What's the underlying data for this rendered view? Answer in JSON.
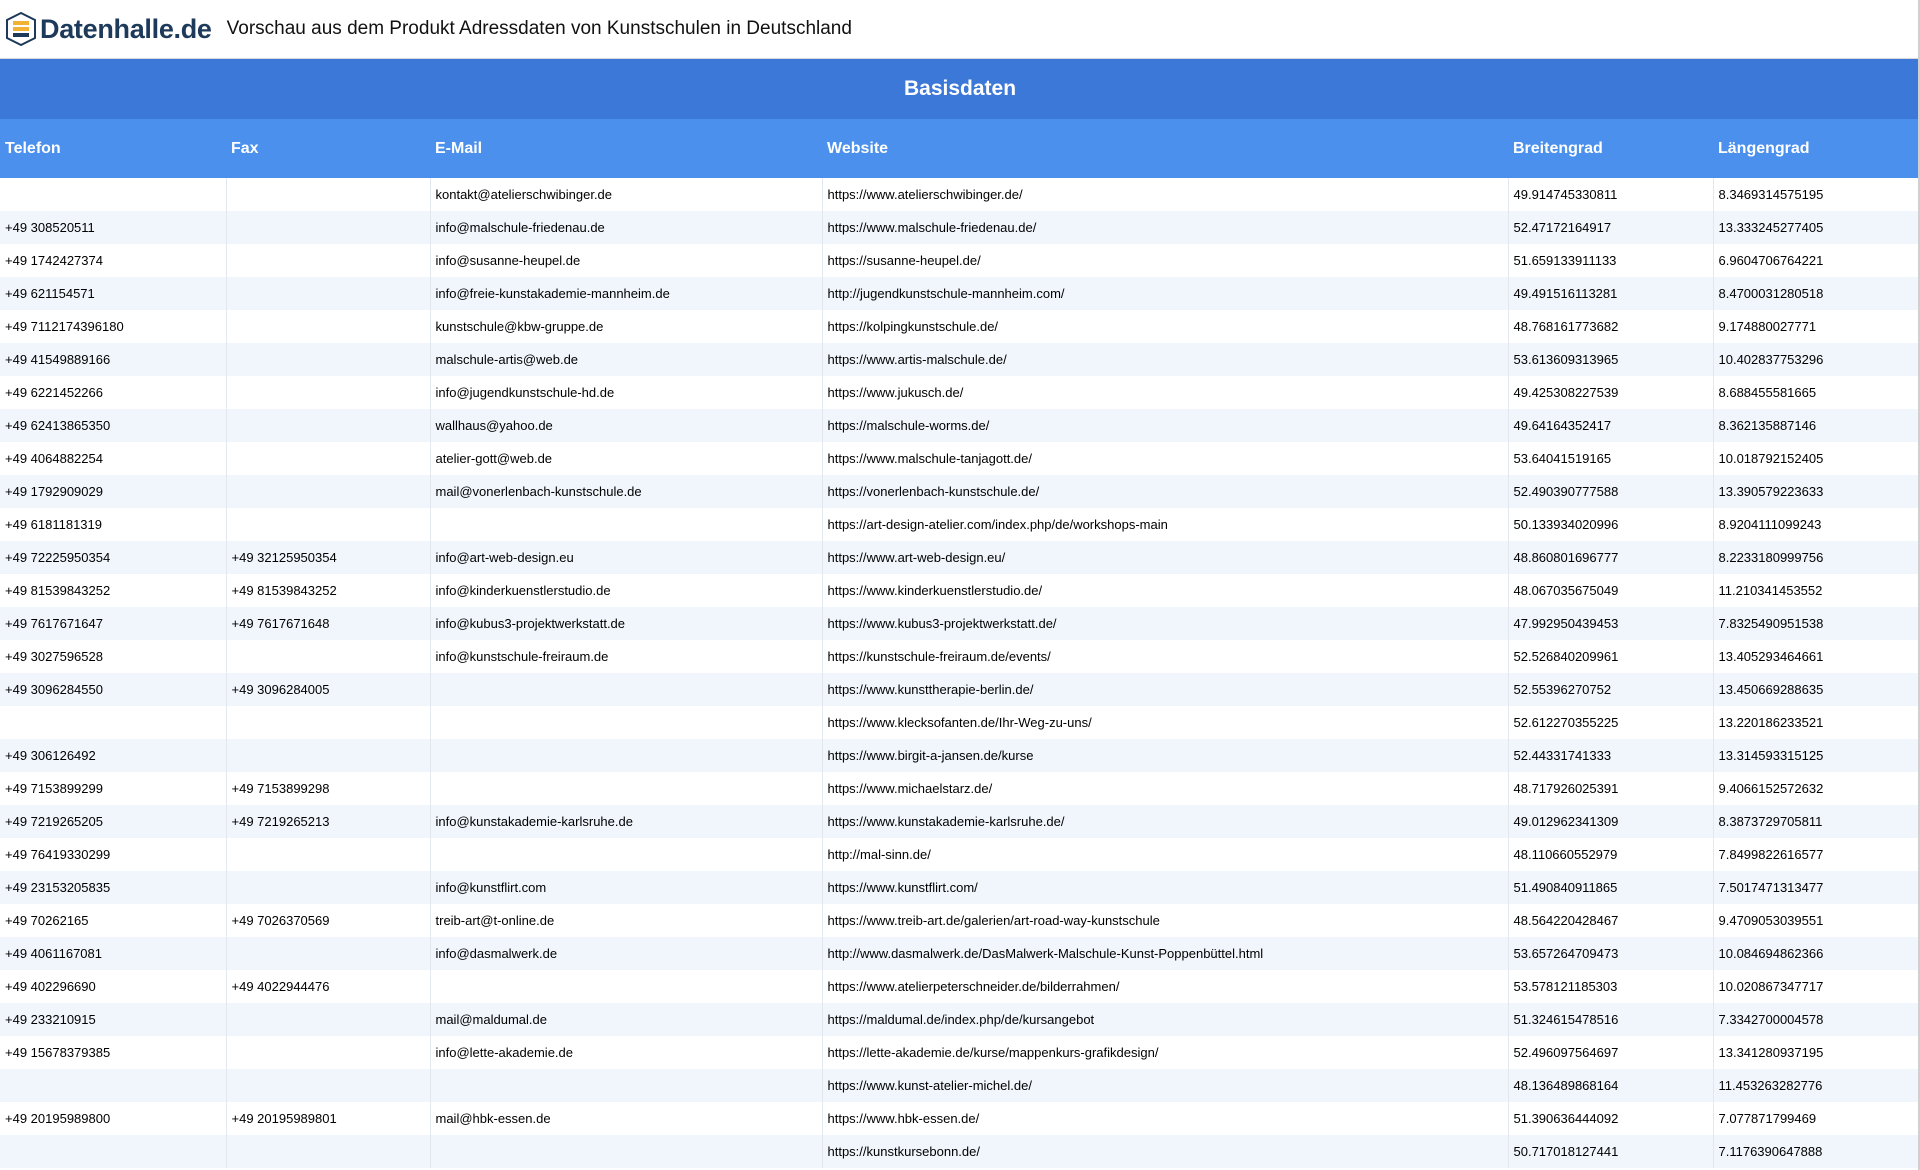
{
  "header": {
    "logo_text": "Datenhalle.de",
    "title": "Vorschau aus dem Produkt Adressdaten von Kunstschulen in Deutschland"
  },
  "table": {
    "group_label": "Basisdaten",
    "columns": [
      "Telefon",
      "Fax",
      "E-Mail",
      "Website",
      "Breitengrad",
      "Längengrad"
    ],
    "rows": [
      [
        "",
        "",
        "kontakt@atelierschwibinger.de",
        "https://www.atelierschwibinger.de/",
        "49.914745330811",
        "8.3469314575195"
      ],
      [
        "+49 308520511",
        "",
        "info@malschule-friedenau.de",
        "https://www.malschule-friedenau.de/",
        "52.47172164917",
        "13.333245277405"
      ],
      [
        "+49 1742427374",
        "",
        "info@susanne-heupel.de",
        "https://susanne-heupel.de/",
        "51.659133911133",
        "6.9604706764221"
      ],
      [
        "+49 621154571",
        "",
        "info@freie-kunstakademie-mannheim.de",
        "http://jugendkunstschule-mannheim.com/",
        "49.491516113281",
        "8.4700031280518"
      ],
      [
        "+49 7112174396180",
        "",
        "kunstschule@kbw-gruppe.de",
        "https://kolpingkunstschule.de/",
        "48.768161773682",
        "9.174880027771"
      ],
      [
        "+49 41549889166",
        "",
        "malschule-artis@web.de",
        "https://www.artis-malschule.de/",
        "53.613609313965",
        "10.402837753296"
      ],
      [
        "+49 6221452266",
        "",
        "info@jugendkunstschule-hd.de",
        "https://www.jukusch.de/",
        "49.425308227539",
        "8.688455581665"
      ],
      [
        "+49 62413865350",
        "",
        "wallhaus@yahoo.de",
        "https://malschule-worms.de/",
        "49.64164352417",
        "8.362135887146"
      ],
      [
        "+49 4064882254",
        "",
        "atelier-gott@web.de",
        "https://www.malschule-tanjagott.de/",
        "53.64041519165",
        "10.018792152405"
      ],
      [
        "+49 1792909029",
        "",
        "mail@vonerlenbach-kunstschule.de",
        "https://vonerlenbach-kunstschule.de/",
        "52.490390777588",
        "13.390579223633"
      ],
      [
        "+49 6181181319",
        "",
        "",
        "https://art-design-atelier.com/index.php/de/workshops-main",
        "50.133934020996",
        "8.9204111099243"
      ],
      [
        "+49 72225950354",
        "+49 32125950354",
        "info@art-web-design.eu",
        "https://www.art-web-design.eu/",
        "48.860801696777",
        "8.2233180999756"
      ],
      [
        "+49 81539843252",
        "+49 81539843252",
        "info@kinderkuenstlerstudio.de",
        "https://www.kinderkuenstlerstudio.de/",
        "48.067035675049",
        "11.210341453552"
      ],
      [
        "+49 7617671647",
        "+49 7617671648",
        "info@kubus3-projektwerkstatt.de",
        "https://www.kubus3-projektwerkstatt.de/",
        "47.992950439453",
        "7.8325490951538"
      ],
      [
        "+49 3027596528",
        "",
        "info@kunstschule-freiraum.de",
        "https://kunstschule-freiraum.de/events/",
        "52.526840209961",
        "13.405293464661"
      ],
      [
        "+49 3096284550",
        "+49 3096284005",
        "",
        "https://www.kunsttherapie-berlin.de/",
        "52.55396270752",
        "13.450669288635"
      ],
      [
        "",
        "",
        "",
        "https://www.klecksofanten.de/Ihr-Weg-zu-uns/",
        "52.612270355225",
        "13.220186233521"
      ],
      [
        "+49 306126492",
        "",
        "",
        "https://www.birgit-a-jansen.de/kurse",
        "52.44331741333",
        "13.314593315125"
      ],
      [
        "+49 7153899299",
        "+49 7153899298",
        "",
        "https://www.michaelstarz.de/",
        "48.717926025391",
        "9.4066152572632"
      ],
      [
        "+49 7219265205",
        "+49 7219265213",
        "info@kunstakademie-karlsruhe.de",
        "https://www.kunstakademie-karlsruhe.de/",
        "49.012962341309",
        "8.3873729705811"
      ],
      [
        "+49 76419330299",
        "",
        "",
        "http://mal-sinn.de/",
        "48.110660552979",
        "7.8499822616577"
      ],
      [
        "+49 23153205835",
        "",
        "info@kunstflirt.com",
        "https://www.kunstflirt.com/",
        "51.490840911865",
        "7.5017471313477"
      ],
      [
        "+49 70262165",
        "+49 7026370569",
        "treib-art@t-online.de",
        "https://www.treib-art.de/galerien/art-road-way-kunstschule",
        "48.564220428467",
        "9.4709053039551"
      ],
      [
        "+49 4061167081",
        "",
        "info@dasmalwerk.de",
        "http://www.dasmalwerk.de/DasMalwerk-Malschule-Kunst-Poppenbüttel.html",
        "53.657264709473",
        "10.084694862366"
      ],
      [
        "+49 402296690",
        "+49 4022944476",
        "",
        "https://www.atelierpeterschneider.de/bilderrahmen/",
        "53.578121185303",
        "10.020867347717"
      ],
      [
        "+49 233210915",
        "",
        "mail@maldumal.de",
        "https://maldumal.de/index.php/de/kursangebot",
        "51.324615478516",
        "7.3342700004578"
      ],
      [
        "+49 15678379385",
        "",
        "info@lette-akademie.de",
        "https://lette-akademie.de/kurse/mappenkurs-grafikdesign/",
        "52.496097564697",
        "13.341280937195"
      ],
      [
        "",
        "",
        "",
        "https://www.kunst-atelier-michel.de/",
        "48.136489868164",
        "11.453263282776"
      ],
      [
        "+49 20195989800",
        "+49 20195989801",
        "mail@hbk-essen.de",
        "https://www.hbk-essen.de/",
        "51.390636444092",
        "7.077871799469"
      ],
      [
        "",
        "",
        "",
        "https://kunstkursebonn.de/",
        "50.717018127441",
        "7.1176390647888"
      ]
    ]
  }
}
